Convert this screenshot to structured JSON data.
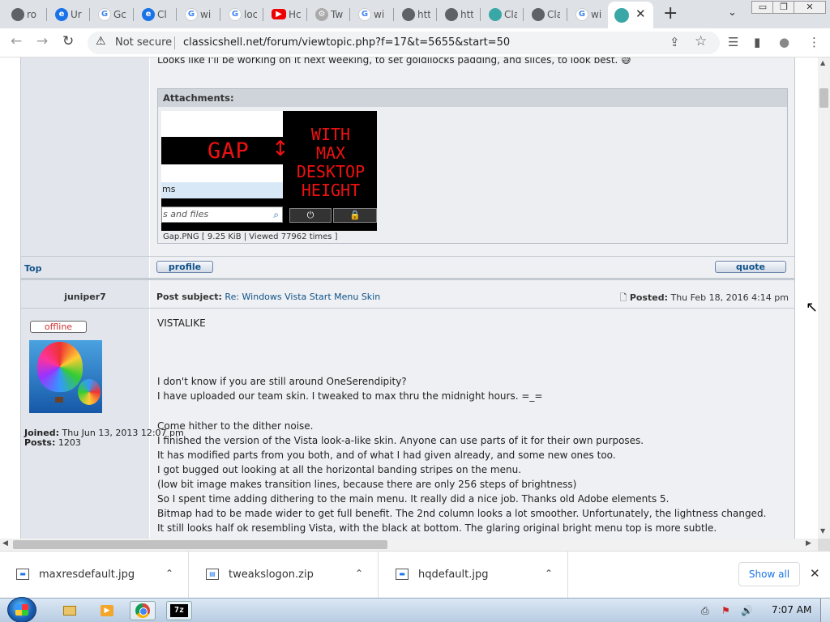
{
  "browser": {
    "tabs": [
      {
        "icon": "globe-icon",
        "glyph": "",
        "title": "ro"
      },
      {
        "icon": "edge-icon",
        "glyph": "e",
        "title": "Ur"
      },
      {
        "icon": "google-icon",
        "glyph": "G",
        "title": "Gc"
      },
      {
        "icon": "edge-icon",
        "glyph": "e",
        "title": "Cl"
      },
      {
        "icon": "google-icon",
        "glyph": "G",
        "title": "wi"
      },
      {
        "icon": "google-icon",
        "glyph": "G",
        "title": "loc"
      },
      {
        "icon": "youtube-icon",
        "glyph": "▶",
        "title": "Hc"
      },
      {
        "icon": "gear-icon",
        "glyph": "⚙",
        "title": "Tw"
      },
      {
        "icon": "google-icon",
        "glyph": "G",
        "title": "wi"
      },
      {
        "icon": "globe-icon",
        "glyph": "",
        "title": "htt"
      },
      {
        "icon": "globe-icon",
        "glyph": "",
        "title": "htt"
      },
      {
        "icon": "teal-site-icon",
        "glyph": "",
        "title": "Cla"
      },
      {
        "icon": "globe-icon",
        "glyph": "",
        "title": "Cla"
      },
      {
        "icon": "google-icon",
        "glyph": "G",
        "title": "wi"
      }
    ],
    "active_tab": {
      "icon": "classic-shell-icon",
      "close": "✕"
    },
    "new_tab": "+",
    "tab_search": "⌄",
    "window_controls": {
      "minimize": "▭",
      "restore": "❐",
      "close": "✕"
    },
    "nav": {
      "back": "←",
      "forward": "→",
      "reload": "↻"
    },
    "security_icon": "⚠",
    "security_label": "Not secure",
    "url": "classicshell.net/forum/viewtopic.php?f=17&t=5655&start=50",
    "share": "⇪",
    "star": "☆",
    "toolbar_icons": [
      "☰",
      "▮",
      "●",
      "⋮"
    ]
  },
  "post_prev": {
    "last_line": "Looks like I'll be working on it next weeking, to set goldilocks padding, and slices, to look best. 😅",
    "attachments_label": "Attachments:",
    "image": {
      "gap": "GAP",
      "gap_arrow": "↕",
      "menu_item": "ms",
      "search_text": "s and files",
      "search_icon": "⌕",
      "caption_lines": [
        "WITH",
        "MAX",
        "DESKTOP",
        "HEIGHT"
      ],
      "power": "⏻",
      "lock": "🔒"
    },
    "attachment_caption": "Gap.PNG [ 9.25 KiB | Viewed 77962 times ]",
    "top_link": "Top",
    "profile_button": "profile",
    "quote_button": "quote"
  },
  "post": {
    "author": "juniper7",
    "subject_label": "Post subject:",
    "subject": "Re: Windows Vista Start Menu Skin",
    "posted_icon": "🗋",
    "posted_label": "Posted:",
    "posted_date": "Thu Feb 18, 2016 4:14 pm",
    "status_badge": "offline",
    "joined_label": "Joined:",
    "joined_value": "Thu Jun 13, 2013 12:07 pm",
    "posts_label": "Posts:",
    "posts_value": "1203",
    "lines": [
      "VISTALIKE",
      "I don't know if you are still around OneSerendipity?",
      "I have uploaded our team skin. I tweaked to max thru the midnight hours. =_=",
      "Come hither to the dither noise.",
      "I finished the version of the Vista look-a-like skin. Anyone can use parts of it for their own purposes.",
      "It has modified parts from you both, and of what I had given already, and some new ones too.",
      "I got bugged out looking at all the horizontal banding stripes on the menu.",
      "(low bit image makes transition lines, because there are only 256 steps of brightness)",
      "So I spent time adding dithering to the main menu. It really did a nice job. Thanks old Adobe elements 5.",
      "Bitmap had to be made wider to get full benefit. The 2nd column looks a lot smoother. Unfortunately, the lightness changed.",
      "It still looks half ok resembling Vista, with the black at bottom. The glaring original bright menu top is more subtle."
    ]
  },
  "scrollbars": {
    "up": "▲",
    "down": "▼",
    "left": "◀",
    "right": "▶"
  },
  "downloads": {
    "items": [
      {
        "name": "maxresdefault.jpg",
        "icon": "image-file-icon"
      },
      {
        "name": "tweakslogon.zip",
        "icon": "zip-file-icon"
      },
      {
        "name": "hqdefault.jpg",
        "icon": "image-file-icon"
      }
    ],
    "chevron": "⌃",
    "show_all": "Show all",
    "close": "✕"
  },
  "taskbar": {
    "apps": [
      {
        "name": "explorer",
        "label": ""
      },
      {
        "name": "media-player",
        "label": "▶"
      },
      {
        "name": "chrome",
        "label": ""
      },
      {
        "name": "7zip",
        "label": "7z"
      }
    ],
    "tray": [
      "⎙",
      "⚑",
      "🔊"
    ],
    "clock": "7:07 AM"
  },
  "cursor": "↖"
}
